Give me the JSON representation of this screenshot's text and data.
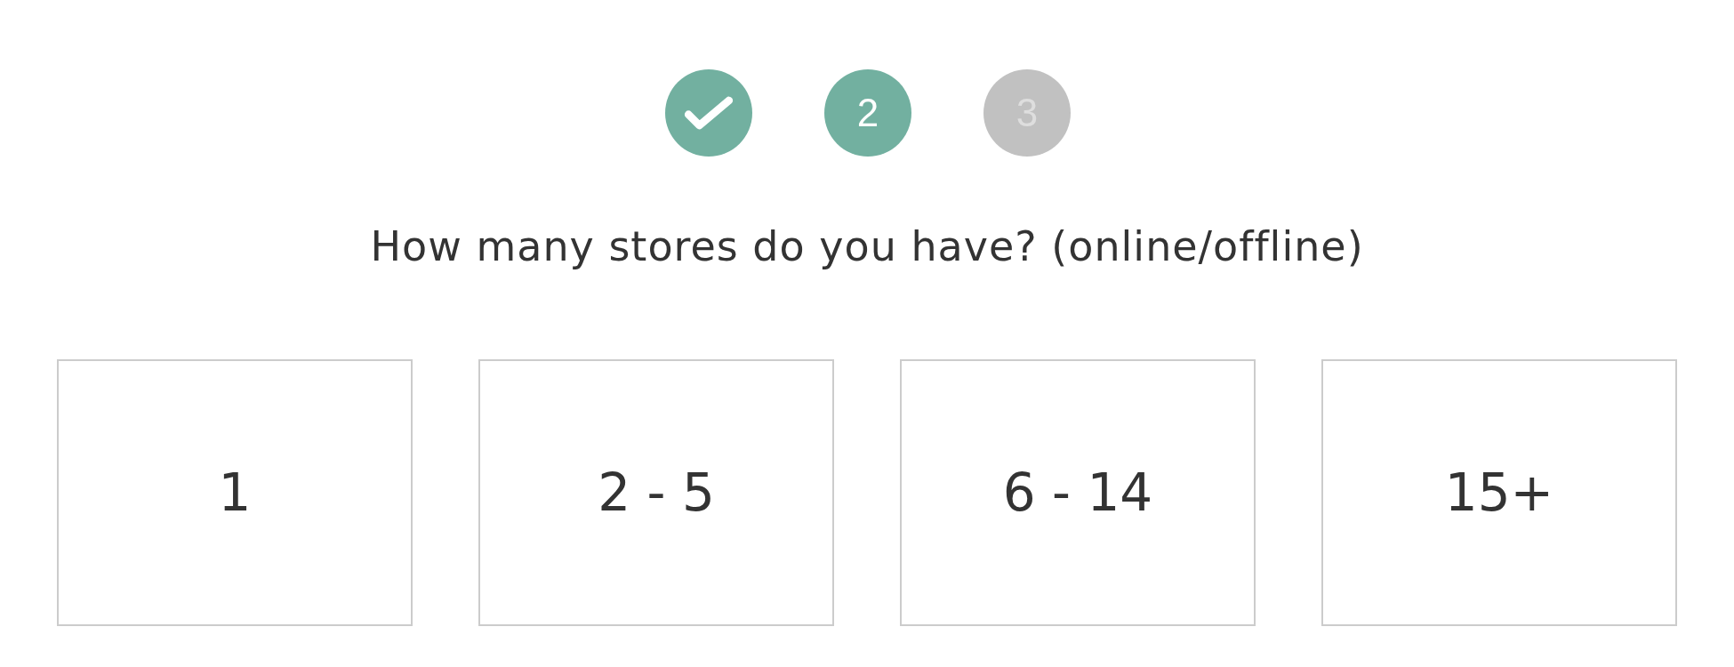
{
  "steps": [
    {
      "done": true,
      "selected": false
    },
    {
      "label": "2",
      "done": false,
      "selected": true
    },
    {
      "label": "3",
      "done": false,
      "selected": false
    }
  ],
  "question": "How many stores do you have? (online/offline)",
  "options": [
    {
      "label": "1",
      "selected": false
    },
    {
      "label": "2 - 5",
      "selected": false
    },
    {
      "label": "6 - 14",
      "selected": false
    },
    {
      "label": "15+",
      "selected": false
    }
  ]
}
